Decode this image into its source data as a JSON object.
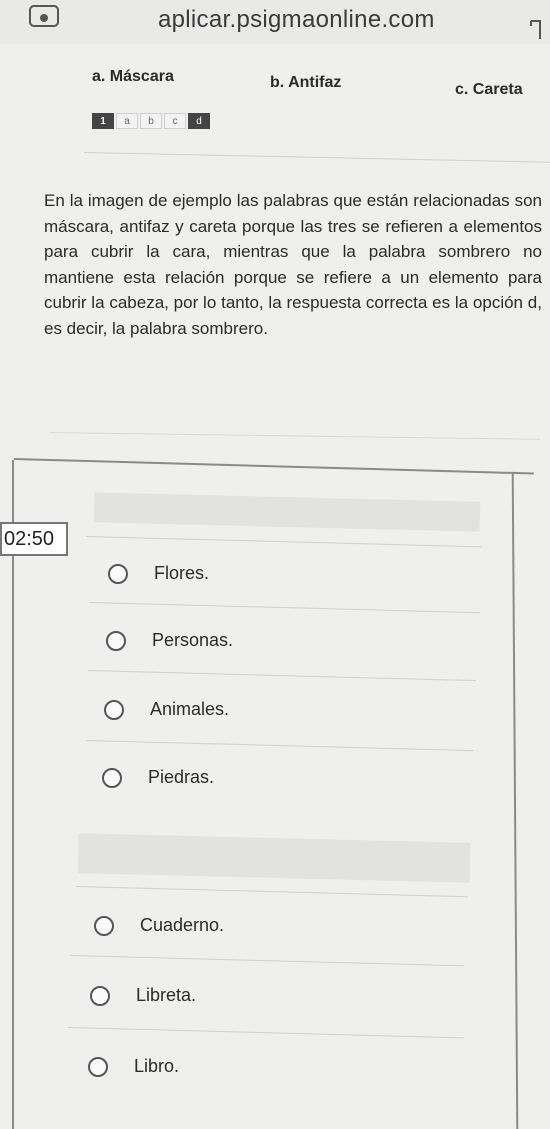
{
  "browser": {
    "url": "aplicar.psigmaonline.com",
    "icons": [
      "site-icon",
      "bookmark-icon"
    ]
  },
  "example": {
    "options": [
      "a. Máscara",
      "b. Antifaz",
      "c. Careta"
    ],
    "mini_answer": {
      "number": "1",
      "letters": [
        "a",
        "b",
        "c",
        "d"
      ],
      "selected": "d"
    }
  },
  "explanation": "En la imagen de ejemplo las palabras que están relacionadas son máscara, antifaz y careta porque las tres se refieren a elementos para cubrir la cara, mientras que la palabra sombrero no mantiene esta relación porque se refiere a un elemento para cubrir la cabeza, por lo tanto, la respuesta correcta es la opción d, es decir, la palabra sombrero.",
  "timer": "02:50",
  "question1": {
    "choices": [
      "Flores.",
      "Personas.",
      "Animales.",
      "Piedras."
    ]
  },
  "question2": {
    "choices": [
      "Cuaderno.",
      "Libreta.",
      "Libro."
    ]
  },
  "colors": {
    "background": "#efefed",
    "text": "#2e2e2e",
    "border": "#8a8a8a"
  }
}
